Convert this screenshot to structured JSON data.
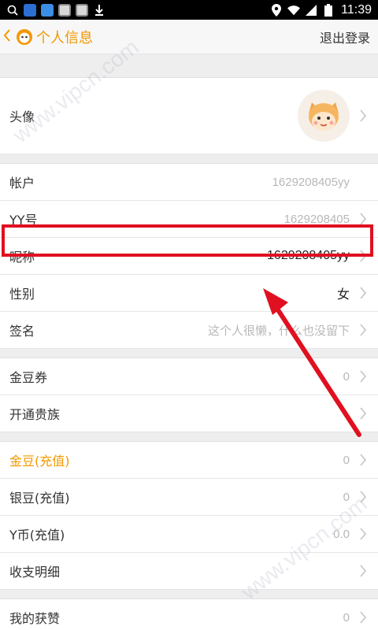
{
  "status_bar": {
    "time": "11:39",
    "battery": "",
    "icons": [
      "search-icon",
      "app-icon",
      "sync-icon",
      "app-icon",
      "app-icon",
      "download-icon",
      "location-icon",
      "wifi-icon",
      "signal-icon",
      "battery-icon"
    ]
  },
  "header": {
    "title": "个人信息",
    "logout": "退出登录"
  },
  "profile": {
    "avatar_label": "头像"
  },
  "account_group": [
    {
      "label": "帐户",
      "value": "1629208405yy"
    },
    {
      "label": "YY号",
      "value": "1629208405"
    },
    {
      "label": "昵称",
      "value": "1629208405yy"
    },
    {
      "label": "性别",
      "value": "女"
    },
    {
      "label": "签名",
      "value": "这个人很懒，什么也没留下"
    }
  ],
  "benefits_group": [
    {
      "label": "金豆券",
      "value": "0"
    },
    {
      "label": "开通贵族",
      "value": ""
    }
  ],
  "currency_group": [
    {
      "label": "金豆(充值)",
      "value": "0"
    },
    {
      "label": "银豆(充值)",
      "value": "0"
    },
    {
      "label": "Y币(充值)",
      "value": "0.0"
    },
    {
      "label": "收支明细",
      "value": ""
    }
  ],
  "likes_group": [
    {
      "label": "我的获赞",
      "value": "0"
    }
  ],
  "watermark": "www.vipcn.com",
  "colors": {
    "accent": "#f39800",
    "highlight": "#e01020"
  }
}
